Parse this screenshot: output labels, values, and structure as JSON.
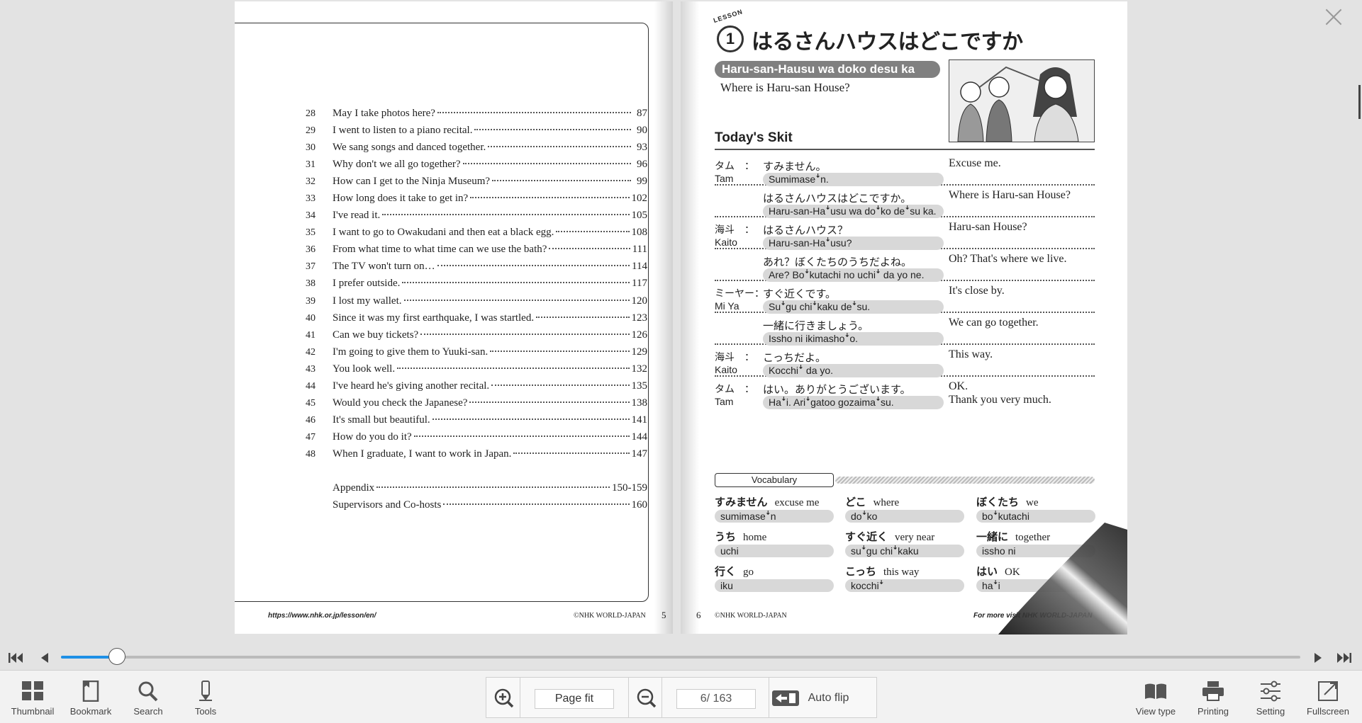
{
  "viewer": {
    "accent_color": "#1e90e6",
    "close_icon": "close-icon"
  },
  "left_page": {
    "toc": [
      {
        "num": "28",
        "title": "May I take photos here?",
        "page": "87"
      },
      {
        "num": "29",
        "title": "I went to listen to a piano recital.",
        "page": "90"
      },
      {
        "num": "30",
        "title": "We sang songs and danced together.",
        "page": "93"
      },
      {
        "num": "31",
        "title": "Why don't we all go together?",
        "page": "96"
      },
      {
        "num": "32",
        "title": "How can I get to the Ninja Museum?",
        "page": "99"
      },
      {
        "num": "33",
        "title": "How long does it take to get in?",
        "page": "102"
      },
      {
        "num": "34",
        "title": "I've read it.",
        "page": "105"
      },
      {
        "num": "35",
        "title": "I want to go to Owakudani and then eat a black egg.",
        "page": "108"
      },
      {
        "num": "36",
        "title": "From what time to what time can we use the bath?",
        "page": "111"
      },
      {
        "num": "37",
        "title": "The TV won't turn on…",
        "page": "114"
      },
      {
        "num": "38",
        "title": "I prefer outside.",
        "page": "117"
      },
      {
        "num": "39",
        "title": "I lost my wallet.",
        "page": "120"
      },
      {
        "num": "40",
        "title": "Since it was my first earthquake, I was startled.",
        "page": "123"
      },
      {
        "num": "41",
        "title": "Can we buy tickets?",
        "page": "126"
      },
      {
        "num": "42",
        "title": "I'm going to give them to Yuuki-san.",
        "page": "129"
      },
      {
        "num": "43",
        "title": "You look well.",
        "page": "132"
      },
      {
        "num": "44",
        "title": "I've heard he's giving another recital.",
        "page": "135"
      },
      {
        "num": "45",
        "title": "Would you check the Japanese?",
        "page": "138"
      },
      {
        "num": "46",
        "title": "It's small but beautiful.",
        "page": "141"
      },
      {
        "num": "47",
        "title": "How do you do it?",
        "page": "144"
      },
      {
        "num": "48",
        "title": "When I graduate, I want to work in Japan.",
        "page": "147"
      }
    ],
    "extras": [
      {
        "title": "Appendix",
        "page": "150-159"
      },
      {
        "title": "Supervisors and Co-hosts",
        "page": "160"
      }
    ],
    "footer_url": "https://www.nhk.or.jp/lesson/en/",
    "footer_copyright": "©NHK WORLD-JAPAN",
    "page_number": "5"
  },
  "right_page": {
    "lesson_word": "LESSON",
    "lesson_number": "1",
    "title_jp": "はるさんハウスはどこですか",
    "title_romaji": "Haru-san-Hausu wa doko desu ka",
    "subtitle_en": "Where is Haru-san House?",
    "skit_heading": "Today's Skit",
    "skit": [
      {
        "speaker_jp": "タム　：",
        "speaker_en": "Tam",
        "jp": "すみません。",
        "romaji": "Sumimaseꜜn.",
        "en": "Excuse me.",
        "en2": ""
      },
      {
        "speaker_jp": "",
        "speaker_en": "",
        "jp": "はるさんハウスはどこですか。",
        "romaji": "Haru-san-Haꜜusu wa doꜜko deꜜsu ka.",
        "en": "Where is Haru-san House?",
        "en2": ""
      },
      {
        "speaker_jp": "海斗　：",
        "speaker_en": "Kaito",
        "jp": "はるさんハウス？",
        "romaji": "Haru-san-Haꜜusu?",
        "en": "Haru-san House?",
        "en2": ""
      },
      {
        "speaker_jp": "",
        "speaker_en": "",
        "jp": "あれ？ぼくたちのうちだよね。",
        "romaji": "Are? Boꜜkutachi no uchiꜜ da yo ne.",
        "en": "Oh? That's where we live.",
        "en2": ""
      },
      {
        "speaker_jp": "ミーヤー：",
        "speaker_en": "Mi Ya",
        "jp": "すぐ近くです。",
        "romaji": "Suꜜgu chiꜜkaku deꜜsu.",
        "en": "It's close by.",
        "en2": ""
      },
      {
        "speaker_jp": "",
        "speaker_en": "",
        "jp": "一緒に行きましょう。",
        "romaji": "Issho ni ikimashoꜜo.",
        "en": "We can go together.",
        "en2": ""
      },
      {
        "speaker_jp": "海斗　：",
        "speaker_en": "Kaito",
        "jp": "こっちだよ。",
        "romaji": "Kocchiꜜ da yo.",
        "en": "This way.",
        "en2": ""
      },
      {
        "speaker_jp": "タム　：",
        "speaker_en": "Tam",
        "jp": "はい。ありがとうございます。",
        "romaji": "Haꜜi. Ariꜜgatoo gozaimaꜜsu.",
        "en": "OK.",
        "en2": "Thank you very much."
      }
    ],
    "vocab_heading": "Vocabulary",
    "vocab": [
      {
        "jp": "すみません",
        "en": "excuse me",
        "romaji": "sumimaseꜜn"
      },
      {
        "jp": "どこ",
        "en": "where",
        "romaji": "doꜜko"
      },
      {
        "jp": "ぼくたち",
        "en": "we",
        "romaji": "boꜜkutachi"
      },
      {
        "jp": "うち",
        "en": "home",
        "romaji": "uchi"
      },
      {
        "jp": "すぐ近く",
        "en": "very near",
        "romaji": "suꜜgu chiꜜkaku"
      },
      {
        "jp": "一緒に",
        "en": "together",
        "romaji": "issho ni"
      },
      {
        "jp": "行く",
        "en": "go",
        "romaji": "iku"
      },
      {
        "jp": "こっち",
        "en": "this way",
        "romaji": "kocchiꜜ"
      },
      {
        "jp": "はい",
        "en": "OK",
        "romaji": "haꜜi"
      }
    ],
    "page_number": "6",
    "footer_copyright": "©NHK WORLD-JAPAN",
    "footer_more": "For more visit NHK WORLD-JAPAN"
  },
  "slider": {
    "progress_fraction": 0.045
  },
  "toolbar": {
    "thumbnail": "Thumbnail",
    "bookmark": "Bookmark",
    "search": "Search",
    "tools": "Tools",
    "zoom_mode": "Page fit",
    "page_indicator": "6/ 163",
    "auto_flip": "Auto flip",
    "view_type": "View type",
    "printing": "Printing",
    "setting": "Setting",
    "fullscreen": "Fullscreen"
  }
}
